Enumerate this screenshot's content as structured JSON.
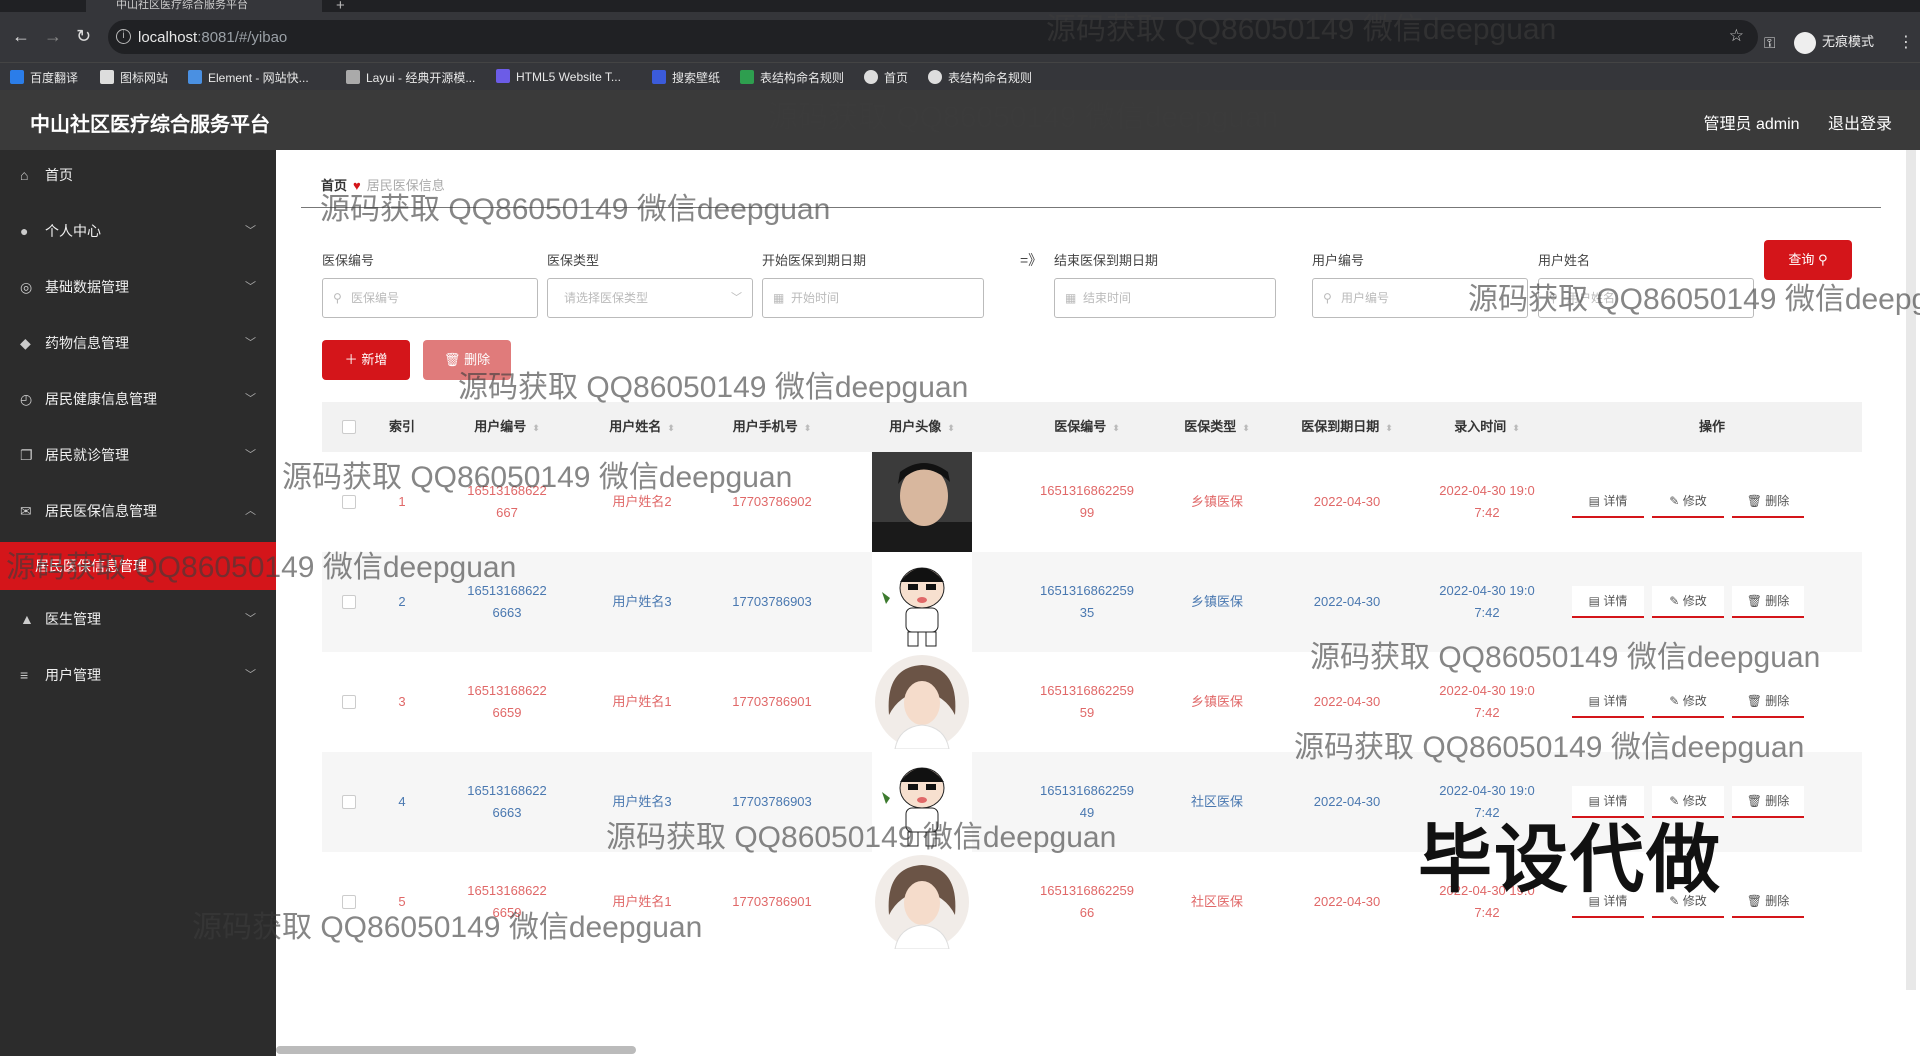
{
  "browser": {
    "tab_title": "中山社区医疗综合服务平台",
    "url_host": "localhost",
    "url_rest": ":8081/#/yibao",
    "incognito_label": "无痕模式",
    "bookmarks": [
      "百度翻译",
      "图标网站",
      "Element - 网站快...",
      "Layui - 经典开源模...",
      "HTML5 Website T...",
      "搜索壁纸",
      "表结构命名规则",
      "首页",
      "表结构命名规则"
    ]
  },
  "header": {
    "title": "中山社区医疗综合服务平台",
    "admin_label": "管理员 admin",
    "logout_label": "退出登录"
  },
  "sidebar": {
    "items": [
      {
        "label": "首页",
        "icon": "home-icon"
      },
      {
        "label": "个人中心",
        "icon": "user-icon"
      },
      {
        "label": "基础数据管理",
        "icon": "globe-icon"
      },
      {
        "label": "药物信息管理",
        "icon": "pill-icon"
      },
      {
        "label": "居民健康信息管理",
        "icon": "gauge-icon"
      },
      {
        "label": "居民就诊管理",
        "icon": "copy-icon"
      },
      {
        "label": "居民医保信息管理",
        "icon": "mail-icon"
      },
      {
        "label": "医生管理",
        "icon": "thumb-icon"
      },
      {
        "label": "用户管理",
        "icon": "db-icon"
      }
    ],
    "active_sub": "居民医保信息管理"
  },
  "breadcrumb": {
    "home": "首页",
    "current": "居民医保信息"
  },
  "filters": {
    "yibao_no_label": "医保编号",
    "yibao_no_placeholder": "医保编号",
    "type_label": "医保类型",
    "type_placeholder": "请选择医保类型",
    "start_label": "开始医保到期日期",
    "start_placeholder": "开始时间",
    "range_sep": "=》",
    "end_label": "结束医保到期日期",
    "end_placeholder": "结束时间",
    "user_no_label": "用户编号",
    "user_no_placeholder": "用户编号",
    "user_name_label": "用户姓名",
    "user_name_placeholder": "用户姓名",
    "query_label": "查询"
  },
  "actions": {
    "add_label": "新增",
    "delete_label": "删除"
  },
  "table": {
    "headers": [
      "索引",
      "用户编号",
      "用户姓名",
      "用户手机号",
      "用户头像",
      "医保编号",
      "医保类型",
      "医保到期日期",
      "录入时间",
      "操作"
    ],
    "op_labels": {
      "detail": "详情",
      "edit": "修改",
      "delete": "删除"
    },
    "rows": [
      {
        "index": "1",
        "user_no": "16513168622667",
        "user_name": "用户姓名2",
        "phone": "17703786902",
        "avatar": "man",
        "yibao_no": "165131686225999",
        "type": "乡镇医保",
        "expire": "2022-04-30",
        "created": "2022-04-30 19:07:42",
        "color": "red"
      },
      {
        "index": "2",
        "user_no": "165131686226663",
        "user_name": "用户姓名3",
        "phone": "17703786903",
        "avatar": "cartoon",
        "yibao_no": "165131686225935",
        "type": "乡镇医保",
        "expire": "2022-04-30",
        "created": "2022-04-30 19:07:42",
        "color": "blue"
      },
      {
        "index": "3",
        "user_no": "165131686226659",
        "user_name": "用户姓名1",
        "phone": "17703786901",
        "avatar": "girl",
        "yibao_no": "165131686225959",
        "type": "乡镇医保",
        "expire": "2022-04-30",
        "created": "2022-04-30 19:07:42",
        "color": "red"
      },
      {
        "index": "4",
        "user_no": "165131686226663",
        "user_name": "用户姓名3",
        "phone": "17703786903",
        "avatar": "cartoon",
        "yibao_no": "165131686225949",
        "type": "社区医保",
        "expire": "2022-04-30",
        "created": "2022-04-30 19:07:42",
        "color": "blue"
      },
      {
        "index": "5",
        "user_no": "165131686226659",
        "user_name": "用户姓名1",
        "phone": "17703786901",
        "avatar": "girl",
        "yibao_no": "165131686225966",
        "type": "社区医保",
        "expire": "2022-04-30",
        "created": "2022-04-30 19:07:42",
        "color": "red"
      }
    ]
  },
  "watermarks": [
    "源码获取 QQ86050149 微信deepguan",
    "毕设代做"
  ]
}
